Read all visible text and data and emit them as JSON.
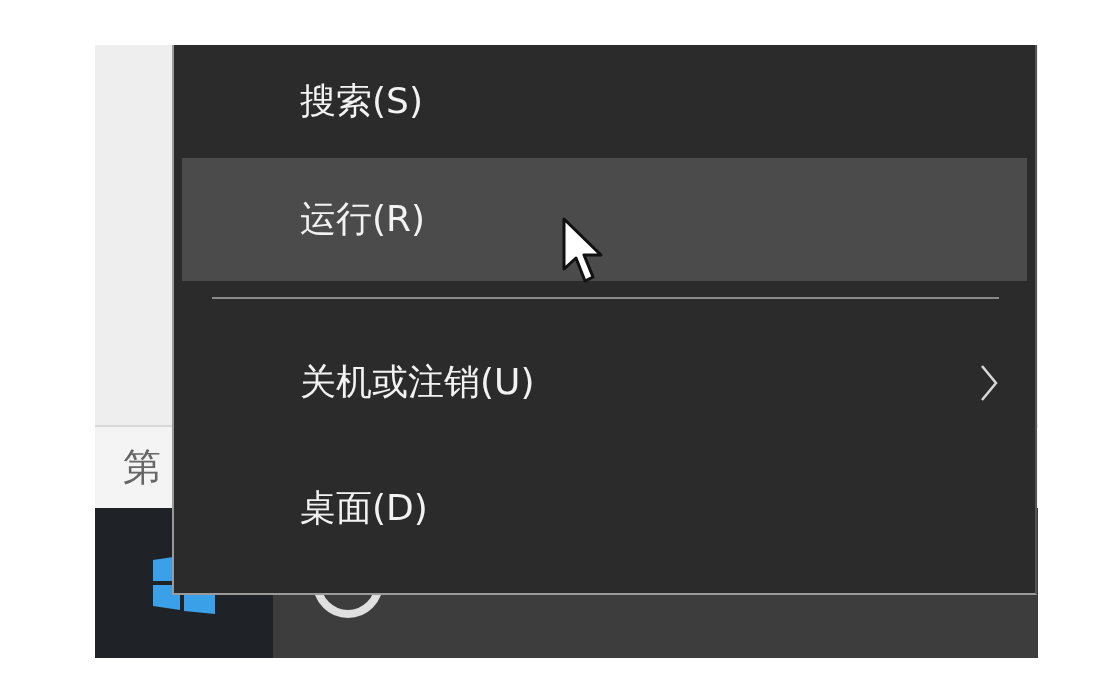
{
  "background_text": "第",
  "menu": {
    "items": [
      {
        "kind": "item",
        "label": "搜索(S)",
        "selected": false,
        "submenu": false
      },
      {
        "kind": "item",
        "label": "运行(R)",
        "selected": true,
        "submenu": false
      },
      {
        "kind": "separator"
      },
      {
        "kind": "item",
        "label": "关机或注销(U)",
        "selected": false,
        "submenu": true
      },
      {
        "kind": "item",
        "label": "桌面(D)",
        "selected": false,
        "submenu": false
      }
    ]
  }
}
